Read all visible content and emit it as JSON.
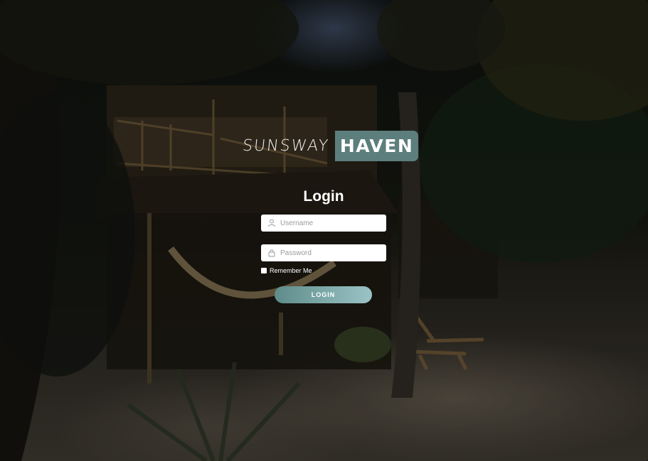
{
  "brand": {
    "name_left": "SUNSWAY",
    "name_right": "HAVEN",
    "accent_color": "#5c7e7d"
  },
  "login": {
    "title": "Login",
    "username": {
      "placeholder": "Username",
      "value": "",
      "icon": "user-icon"
    },
    "password": {
      "placeholder": "Password",
      "value": "",
      "icon": "lock-icon"
    },
    "remember_label": "Remember Me",
    "remember_checked": false,
    "button_label": "LOGIN",
    "button_gradient": [
      "#5f8c8a",
      "#9ac3c6"
    ]
  }
}
